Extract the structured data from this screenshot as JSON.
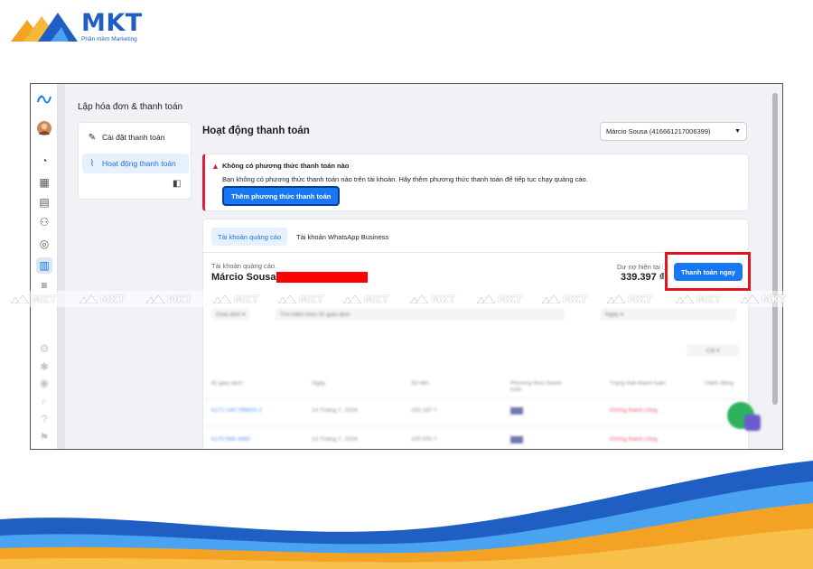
{
  "brand": {
    "name": "MKT",
    "tagline": "Phần mềm Marketing",
    "colors": {
      "blue": "#1f5fc4",
      "orange": "#f4a224",
      "light_blue": "#4aa3f0"
    }
  },
  "section_title": "Lập hóa đơn & thanh toán",
  "rail": {
    "icons": [
      "meta-logo-icon",
      "avatar",
      "dashboard-icon",
      "table-icon",
      "document-icon",
      "people-icon",
      "audience-icon",
      "billing-icon",
      "menu-icon",
      "settings-icon",
      "bug-icon",
      "notification-icon",
      "search-icon",
      "help-icon",
      "report-icon"
    ]
  },
  "nav": {
    "items": [
      {
        "label": "Cài đặt thanh toán",
        "icon": "tag-icon"
      },
      {
        "label": "Hoạt động thanh toán",
        "icon": "activity-icon"
      }
    ]
  },
  "main": {
    "title": "Hoạt động thanh toán",
    "account_select": "Márcio Sousa (416661217006399)"
  },
  "alert": {
    "title": "Không có phương thức thanh toán nào",
    "body": "Bạn không có phương thức thanh toán nào trên tài khoản. Hãy thêm phương thức thanh toán để tiếp tục chạy quảng cáo.",
    "button": "Thêm phương thức thanh toán"
  },
  "tabs": [
    {
      "label": "Tài khoản quảng cáo"
    },
    {
      "label": "Tài khoản WhatsApp Business"
    }
  ],
  "account": {
    "label": "Tài khoản quảng cáo",
    "name": "Márcio Sousa (",
    "balance_label": "Dư nợ hiện tại ⓘ",
    "balance_value": "339.397 ₫",
    "pay_button": "Thanh toán ngay"
  },
  "blurred_table": {
    "filters": [
      "Giao dịch ▾",
      "Tìm kiếm theo ID giao dịch",
      "Ngày ▾"
    ],
    "columns_button": "Cột ▾",
    "headers": [
      "ID giao dịch",
      "Ngày",
      "Số tiền",
      "Phương thức thanh toán",
      "Trạng thái thanh toán",
      "Hành động"
    ],
    "rows": [
      {
        "id": "6171 140 766800 2",
        "date": "14 Tháng 7, 2024",
        "amount": "250.187 ₫",
        "status": "Không thành công"
      },
      {
        "id": "6170 686 4460",
        "date": "13 Tháng 7, 2024",
        "amount": "100.000 ₫",
        "status": "Không thành công"
      }
    ]
  },
  "watermark": "MKT"
}
